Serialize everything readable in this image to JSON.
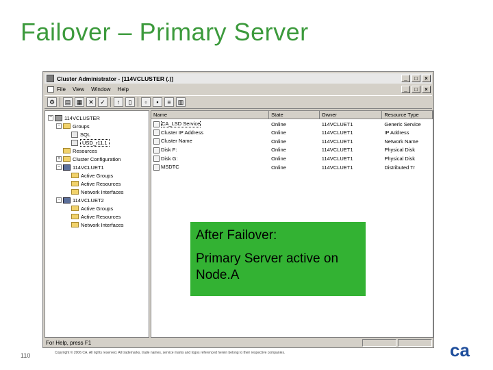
{
  "slide": {
    "title": "Failover – Primary Server",
    "page_number": "110",
    "copyright": "Copyright © 2006 CA. All rights reserved. All trademarks, trade names, service marks and logos referenced herein belong to their respective companies.",
    "logo_text": "ca"
  },
  "window": {
    "title": "Cluster Administrator - [114VCLUSTER (.)]",
    "minimize": "_",
    "maximize": "□",
    "close": "×",
    "menu": [
      "File",
      "View",
      "Window",
      "Help"
    ],
    "child_controls": [
      "_",
      "□",
      "×"
    ],
    "status": "For Help, press F1"
  },
  "toolbar": {
    "icons": [
      "cluster-icon",
      "properties-icon",
      "tree-icon",
      "delete-icon",
      "check-icon",
      "open-icon",
      "page-icon",
      "large-icons-icon",
      "small-icons-icon",
      "list-icon",
      "details-icon"
    ]
  },
  "tree": [
    {
      "label": "114VCLUSTER",
      "level": 0,
      "expander": "−",
      "icon": "cluster"
    },
    {
      "label": "Groups",
      "level": 1,
      "expander": "−",
      "icon": "folder"
    },
    {
      "label": "SQL",
      "level": 2,
      "expander": "",
      "icon": "group"
    },
    {
      "label": "USD_r11.1",
      "level": 2,
      "expander": "",
      "icon": "group",
      "selected": true
    },
    {
      "label": "Resources",
      "level": 1,
      "expander": "",
      "icon": "folder"
    },
    {
      "label": "Cluster Configuration",
      "level": 1,
      "expander": "+",
      "icon": "folder"
    },
    {
      "label": "114VCLUET1",
      "level": 1,
      "expander": "−",
      "icon": "node"
    },
    {
      "label": "Active Groups",
      "level": 2,
      "expander": "",
      "icon": "folder"
    },
    {
      "label": "Active Resources",
      "level": 2,
      "expander": "",
      "icon": "folder"
    },
    {
      "label": "Network Interfaces",
      "level": 2,
      "expander": "",
      "icon": "folder"
    },
    {
      "label": "114VCLUET2",
      "level": 1,
      "expander": "−",
      "icon": "node"
    },
    {
      "label": "Active Groups",
      "level": 2,
      "expander": "",
      "icon": "folder"
    },
    {
      "label": "Active Resources",
      "level": 2,
      "expander": "",
      "icon": "folder"
    },
    {
      "label": "Network Interfaces",
      "level": 2,
      "expander": "",
      "icon": "folder"
    }
  ],
  "list": {
    "columns": [
      "Name",
      "State",
      "Owner",
      "Resource Type"
    ],
    "rows": [
      [
        "CA_LSD Service",
        "Online",
        "114VCLUET1",
        "Generic Service"
      ],
      [
        "Cluster IP Address",
        "Online",
        "114VCLUET1",
        "IP Address"
      ],
      [
        "Cluster Name",
        "Online",
        "114VCLUET1",
        "Network Name"
      ],
      [
        "Disk F:",
        "Online",
        "114VCLUET1",
        "Physical Disk"
      ],
      [
        "Disk G:",
        "Online",
        "114VCLUET1",
        "Physical Disk"
      ],
      [
        "MSDTC",
        "Online",
        "114VCLUET1",
        "Distributed Tr"
      ]
    ]
  },
  "callout": {
    "line1": "After Failover:",
    "line2": "Primary Server active on Node.A"
  },
  "colors": {
    "title": "#3c9a3c",
    "callout": "#33b233",
    "logo": "#1f4e9c"
  }
}
